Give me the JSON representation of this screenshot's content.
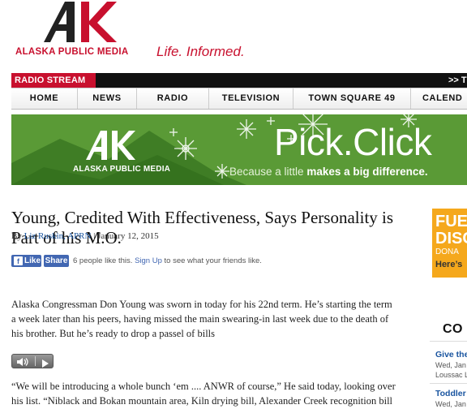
{
  "brand": {
    "logo_text": "ALASKA PUBLIC MEDIA",
    "tagline": "Life. Informed.",
    "accent_color": "#c8102e"
  },
  "radio": {
    "stream_label": "RADIO STREAM",
    "arrows": ">> T"
  },
  "nav": {
    "items": [
      {
        "label": "HOME"
      },
      {
        "label": "NEWS"
      },
      {
        "label": "RADIO"
      },
      {
        "label": "TELEVISION"
      },
      {
        "label": "TOWN SQUARE 49"
      },
      {
        "label": "CALEND"
      }
    ]
  },
  "banner": {
    "brand": "ALASKA PUBLIC MEDIA",
    "headline": "Pick.Click",
    "sub_prefix": "Because a little ",
    "sub_bold": "makes a big difference."
  },
  "article": {
    "title": "Young, Credited With Effectiveness, Says Personality is Part of his M.O.",
    "byline_prefix": "By ",
    "author": "Liz Ruskin, APRN",
    "byline_sep": " | ",
    "date": "January 12, 2015",
    "paragraph1": "Alaska Congressman Don Young was sworn in today for his 22nd term. He’s starting the term a week later than his peers, having missed the main swearing-in last week due to the death of his brother.  But he’s ready to drop a passel of bills",
    "paragraph2": "“We will be introducing a whole bunch ‘em .... ANWR of course,” He said today, looking over his list. “Niblack and Bokan mountain area, Kiln drying bill, Alexander Creek recognition bill"
  },
  "facebook": {
    "like_label": "Like",
    "share_label": "Share",
    "count_text": "6 people like this.",
    "signup_label": "Sign Up",
    "signup_suffix": " to see what your friends like."
  },
  "sidebar": {
    "ad_line1": "FUE",
    "ad_line2": "DISC",
    "ad_line3": "DONA",
    "ad_line4": "Here’s",
    "section_heading": "CO",
    "events": [
      {
        "title": "Give the",
        "meta1": "Wed, Jan",
        "meta2": "Loussac Li"
      },
      {
        "title": "Toddler",
        "meta1": "Wed, Jan",
        "meta2": ""
      }
    ]
  }
}
